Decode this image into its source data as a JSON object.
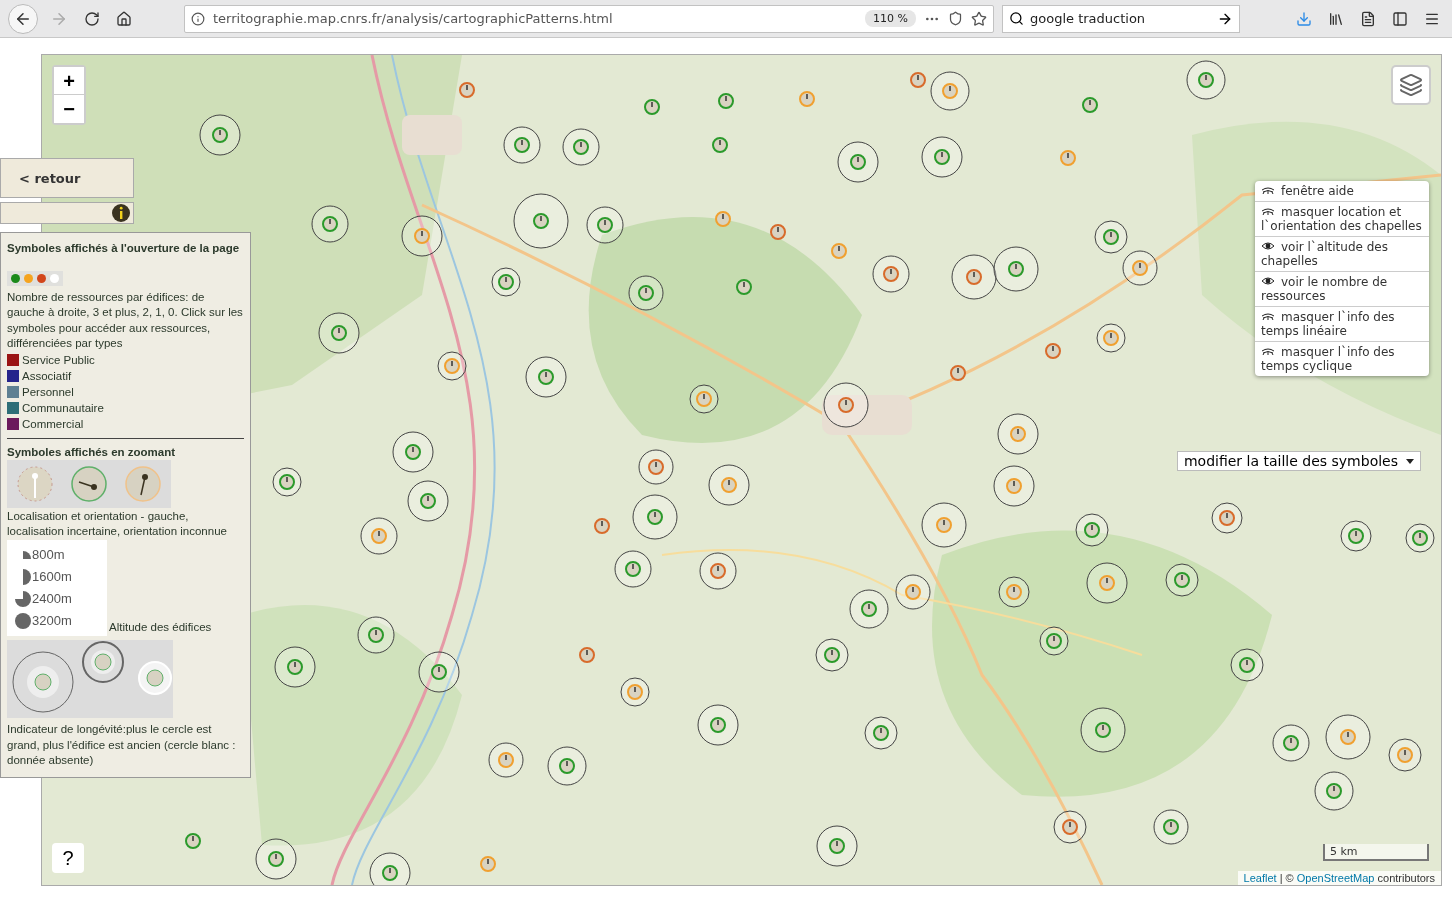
{
  "browser": {
    "url": "territographie.map.cnrs.fr/analysis/cartographicPatterns.html",
    "zoom": "110 %",
    "search": "google traduction"
  },
  "map": {
    "zoom_in": "+",
    "zoom_out": "−",
    "help": "?",
    "scale": "5 km",
    "attribution": {
      "leaflet": "Leaflet",
      "separator": "| ©",
      "osm": "OpenStreetMap",
      "rest": "contributors"
    }
  },
  "panel": {
    "back": "< retour",
    "legend": {
      "title_opening": "Symboles affichés à l'ouverture de la page",
      "resource_dots": [
        {
          "color": "#1b8a1b"
        },
        {
          "color": "#f5a41f"
        },
        {
          "color": "#d2461b"
        },
        {
          "color": "#ffffff"
        }
      ],
      "resource_text": "Nombre de ressources par édifices: de gauche à droite, 3 et plus, 2, 1, 0. Click sur les symboles pour accéder aux ressources, différenciées par types",
      "types": [
        {
          "label": "Service Public",
          "color": "#9a1414"
        },
        {
          "label": "Associatif",
          "color": "#25248c"
        },
        {
          "label": "Personnel",
          "color": "#5e8093"
        },
        {
          "label": "Communautaire",
          "color": "#2d6e78"
        },
        {
          "label": "Commercial",
          "color": "#6b1a5c"
        }
      ],
      "title_zoom": "Symboles affichés en zoomant",
      "orientation_text": "Localisation et orientation - gauche, localisation incertaine, orientation inconnue",
      "altitudes": [
        {
          "label": "800m"
        },
        {
          "label": "1600m"
        },
        {
          "label": "2400m"
        },
        {
          "label": "3200m"
        }
      ],
      "altitude_title": "Altitude des édifices",
      "longevity_text": "Indicateur de longévité:plus le cercle est grand, plus l'édifice est ancien (cercle blanc : donnée absente)"
    }
  },
  "layer_menu": [
    {
      "label": "fenêtre aide",
      "eye_open": false
    },
    {
      "label": "masquer location et l`orientation des chapelles",
      "eye_open": false
    },
    {
      "label": "voir l`altitude des chapelles",
      "eye_open": true
    },
    {
      "label": "voir le nombre de ressources",
      "eye_open": true
    },
    {
      "label": "masquer l`info des temps linéaire",
      "eye_open": false
    },
    {
      "label": "masquer l`info des temps cyclique",
      "eye_open": false
    }
  ],
  "size_select": "modifier la taille des symboles"
}
